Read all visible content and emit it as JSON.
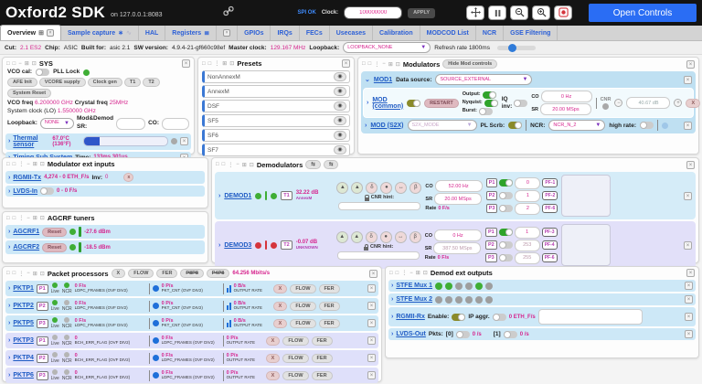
{
  "header": {
    "title": "Oxford2 SDK",
    "subtitle": "on 127.0.0.1:8083",
    "spi_status": "SPI OK",
    "clock_label": "Clock:",
    "clock_value": "100000000",
    "apply_label": "APPLY",
    "open_controls_label": "Open Controls"
  },
  "tabs": {
    "overview": "Overview",
    "sample_capture": "Sample capture",
    "hal": "HAL",
    "registers": "Registers",
    "gpios": "GPIOs",
    "irqs": "IRQs",
    "fecs": "FECs",
    "usecases": "Usecases",
    "calibration": "Calibration",
    "modcod": "MODCOD List",
    "ncr": "NCR",
    "gse": "GSE Filtering"
  },
  "infobar": {
    "cut_label": "Cut:",
    "cut_value": "2.1 ES2",
    "chip_label": "Chip:",
    "chip_value": "ASIC",
    "built_label": "Built for:",
    "built_value": "asic 2.1",
    "sw_label": "SW version:",
    "sw_value": "4.9.4-21-gf660c98ef",
    "mclk_label": "Master clock:",
    "mclk_value": "129.167 MHz",
    "loopback_label": "Loopback:",
    "loopback_value": "LOOPBACK_NONE",
    "refresh_label": "Refresh rate 1800ms"
  },
  "sys": {
    "title": "SYS",
    "vco_cal_label": "VCO cal:",
    "pll_lock_label": "PLL Lock",
    "buttons": [
      {
        "label": "AFE Init"
      },
      {
        "label": "VCORE supply"
      },
      {
        "label": "Clock gen"
      },
      {
        "label": "T1"
      },
      {
        "label": "T2"
      },
      {
        "label": "System Reset"
      }
    ],
    "vco_freq_label": "VCO freq",
    "vco_freq_value": "6.200000 GHz",
    "crystal_label": "Crystal freq",
    "crystal_value": "25MHz",
    "sysclk_label": "System clock (LO)",
    "sysclk_value": "1.550000 GHz",
    "loopback_label": "Loopback:",
    "loopback_value": "NONE",
    "sr_label": "Mod&Demod SR:",
    "co_label": "CO:",
    "thermal_label": "Thermal sensor",
    "thermal_value": "67.0°C (136°F)",
    "timing_label": "Timing Sub System",
    "timing_time_label": "Time:",
    "timing_value": "133ms 301us"
  },
  "presets": {
    "title": "Presets",
    "eye_icon": "◉",
    "items": [
      {
        "label": "NonAnnexM"
      },
      {
        "label": "AnnexM"
      },
      {
        "label": "DSF"
      },
      {
        "label": "SF5"
      },
      {
        "label": "SF6"
      },
      {
        "label": "SF7"
      }
    ]
  },
  "modulators": {
    "title": "Modulators",
    "hide_label": "Hide Mod controls",
    "mod1_label": "MOD1",
    "datasource_label": "Data source:",
    "datasource_value": "SOURCE_EXTERNAL",
    "common_label": "MOD (common)",
    "restart_label": "RESTART",
    "output_label": "Output:",
    "nyquist_label": "Nyquist:",
    "burst_label": "Burst:",
    "iqinv_label": "IQ inv:",
    "co_label": "CO",
    "co_value": "0 Hz",
    "sr_label": "SR",
    "sr_value": "20.00 MSps",
    "cnr_label": "CNR",
    "cnr_value": "40.67 dB",
    "minus_label": "−",
    "plus_label": "+",
    "x_label": "X",
    "s2x_label": "MOD (S2X)",
    "s2x_mode_value": "S2X_MODE",
    "plscrb_label": "PL Scrb:",
    "ncr_label": "NCR:",
    "ncr_value": "NCR_N_2",
    "highrate_label": "high rate:"
  },
  "ext_inputs": {
    "title": "Modulator ext inputs",
    "rgmii_label": "RGMII-Tx",
    "rgmii_value": "4,274 - 0 ETH_F/s",
    "inv_label": "Inv:",
    "inv_value": "0",
    "lvds_label": "LVDS-In",
    "lvds_value": "0 - 0 F/s"
  },
  "agcrf": {
    "title": "AGCRF tuners",
    "rows": [
      {
        "label": "AGCRF1",
        "reset_label": "Reset",
        "value": "-27.6 dBm"
      },
      {
        "label": "AGCRF2",
        "reset_label": "Reset",
        "value": "-18.5 dBm"
      }
    ]
  },
  "demodulators": {
    "title": "Demodulators",
    "swap_icon": "⇆",
    "cnr_hint_label": "CNR hint:",
    "co_label": "CO",
    "sr_label": "SR",
    "rate_label": "Rate",
    "tool_icons": [
      {
        "glyph": "▲"
      },
      {
        "glyph": "▲"
      },
      {
        "glyph": "δ"
      },
      {
        "glyph": "●"
      },
      {
        "glyph": "↔"
      },
      {
        "glyph": "β"
      }
    ],
    "rows": [
      {
        "row_class": "drow dblue",
        "label": "DEMOD1",
        "dot_class": "ddot g",
        "bar_class": "dbar g",
        "tuner": "T1",
        "snr": "32.22 dB",
        "standard": "AnnexM",
        "co_value": "52.00 Hz",
        "sr_value": "20.00 MSps",
        "rate_value": "0 F/s",
        "ports": [
          {
            "label": "P1",
            "toggle_class": "tgl on",
            "value": "0",
            "pf": "PF-1"
          },
          {
            "label": "P2",
            "toggle_class": "tgl",
            "value": "1",
            "pf": "PF-2"
          },
          {
            "label": "P3",
            "toggle_class": "tgl",
            "value": "2",
            "pf": "PF-6"
          }
        ]
      },
      {
        "row_class": "drow dlav",
        "label": "DEMOD3",
        "dot_class": "ddot r",
        "bar_class": "dbar r",
        "tuner": "T2",
        "snr": "-0.07 dB",
        "standard": "UNKNOWN",
        "co_value": "0 Hz",
        "sr_value": "387.50 MSps",
        "rate_value": "0 F/s",
        "ports": [
          {
            "label": "P1",
            "toggle_class": "tgl on",
            "value": "1",
            "pf": "PF-3"
          },
          {
            "label": "P2",
            "toggle_class": "tgl",
            "value": "253",
            "pf": "PF-4"
          },
          {
            "label": "P3",
            "toggle_class": "tgl",
            "value": "255",
            "pf": "PF-6"
          }
        ]
      }
    ]
  },
  "pktp": {
    "title": "Packet processors",
    "x_label": "X",
    "flow_label": "FLOW",
    "fer_label": "FER",
    "p8p8_label": "P8P8",
    "p4p8_label": "P4P8",
    "bitrate": "64.256 Mbits/s",
    "live_label": "Live",
    "ncr_label": "NCR",
    "rows": [
      {
        "row_class": "prow blue",
        "label": "PKTP1",
        "port": "P1",
        "live_class": "sdot on",
        "ncr_class": "sdot on",
        "m1v": "0 F/s",
        "m1l": "LDPC_FRAMES (OVF DIV2)",
        "m2v": "0 P/s",
        "m2l": "PKT_CNT (OVF DIV2)",
        "m3v": "0 B/s",
        "m3l": "OUTPUT RATE"
      },
      {
        "row_class": "prow blue",
        "label": "PKTP2",
        "port": "P2",
        "live_class": "sdot on",
        "ncr_class": "sdot off",
        "m1v": "0 F/s",
        "m1l": "LDPC_FRAMES (OVF DIV2)",
        "m2v": "0 P/s",
        "m2l": "PKT_CNT (OVF DIV2)",
        "m3v": "0 B/s",
        "m3l": "OUTPUT RATE"
      },
      {
        "row_class": "prow blue",
        "label": "PKTP5",
        "port": "P3",
        "live_class": "sdot on",
        "ncr_class": "sdot off",
        "m1v": "0 F/s",
        "m1l": "LDPC_FRAMES (OVF DIV2)",
        "m2v": "0 P/s",
        "m2l": "PKT_CNT (OVF DIV2)",
        "m3v": "0 B/s",
        "m3l": "OUTPUT RATE"
      },
      {
        "row_class": "prow lav",
        "label": "PKTP3",
        "port": "P1",
        "live_class": "sdot off",
        "ncr_class": "sdot off",
        "m1v": "0",
        "m1l": "BCH_ERR_FLAG (OVF DIV2)",
        "m2v": "0 F/s",
        "m2l": "LDPC_FRAMES (OVF DIV2)",
        "m3v": "0 P/s",
        "m3l": "OUTPUT RATE"
      },
      {
        "row_class": "prow lav",
        "label": "PKTP4",
        "port": "P2",
        "live_class": "sdot off",
        "ncr_class": "sdot off",
        "m1v": "0",
        "m1l": "BCH_ERR_FLAG (OVF DIV2)",
        "m2v": "0 F/s",
        "m2l": "LDPC_FRAMES (OVF DIV2)",
        "m3v": "0 P/s",
        "m3l": "OUTPUT RATE"
      },
      {
        "row_class": "prow lav",
        "label": "PKTP6",
        "port": "P3",
        "live_class": "sdot off",
        "ncr_class": "sdot off",
        "m1v": "0",
        "m1l": "BCH_ERR_FLAG (OVF DIV2)",
        "m2v": "0 F/s",
        "m2l": "LDPC_FRAMES (OVF DIV2)",
        "m3v": "0 P/s",
        "m3l": "OUTPUT RATE"
      }
    ]
  },
  "demod_out": {
    "title": "Demod ext outputs",
    "stfe1_label": "STFE Mux 1",
    "stfe1_dots": [
      {
        "cls": "ldot on"
      },
      {
        "cls": "ldot on"
      },
      {
        "cls": "ldot off"
      },
      {
        "cls": "ldot off"
      },
      {
        "cls": "ldot on"
      },
      {
        "cls": "ldot off"
      }
    ],
    "stfe2_label": "STFE Mux 2",
    "stfe2_dots": [
      {
        "cls": "ldot off"
      },
      {
        "cls": "ldot off"
      },
      {
        "cls": "ldot off"
      },
      {
        "cls": "ldot off"
      },
      {
        "cls": "ldot off"
      },
      {
        "cls": "ldot off"
      }
    ],
    "rgmii_label": "RGMII-Rx",
    "enable_label": "Enable:",
    "ipaggr_label": "IP aggr.",
    "rgmii_value": "0 ETH_F/s",
    "lvds_label": "LVDS-Out",
    "pkts_label": "Pkts:",
    "p0_label": "[0]",
    "p0_value": "0 /s",
    "p1_label": "[1]",
    "p1_value": "0 /s"
  }
}
